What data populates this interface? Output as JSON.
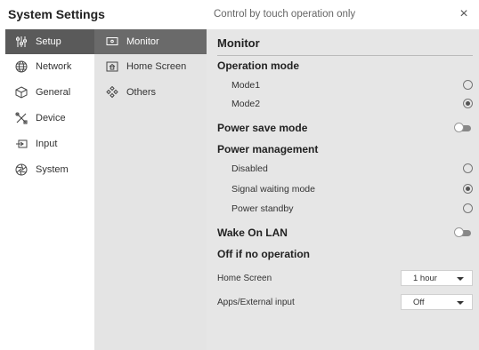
{
  "window": {
    "title": "System Settings",
    "hint": "Control by touch operation only",
    "close_glyph": "×"
  },
  "nav": {
    "items": [
      {
        "label": "Setup",
        "icon": "sliders-icon"
      },
      {
        "label": "Network",
        "icon": "globe-icon"
      },
      {
        "label": "General",
        "icon": "cube-icon"
      },
      {
        "label": "Device",
        "icon": "tools-icon"
      },
      {
        "label": "Input",
        "icon": "input-icon"
      },
      {
        "label": "System",
        "icon": "aperture-icon"
      }
    ],
    "active": "Setup"
  },
  "subnav": {
    "items": [
      {
        "label": "Monitor",
        "icon": "monitor-icon"
      },
      {
        "label": "Home Screen",
        "icon": "home-icon"
      },
      {
        "label": "Others",
        "icon": "diamonds-icon"
      }
    ],
    "active": "Monitor"
  },
  "panel": {
    "title": "Monitor",
    "operation_mode": {
      "heading": "Operation mode",
      "options": [
        {
          "label": "Mode1",
          "selected": false
        },
        {
          "label": "Mode2",
          "selected": true
        }
      ]
    },
    "power_save": {
      "label": "Power save mode",
      "on": false
    },
    "power_management": {
      "heading": "Power management",
      "options": [
        {
          "label": "Disabled",
          "selected": false
        },
        {
          "label": "Signal waiting mode",
          "selected": true
        },
        {
          "label": "Power standby",
          "selected": false
        }
      ]
    },
    "wake_on_lan": {
      "label": "Wake On LAN",
      "on": false
    },
    "off_if_no_op": {
      "heading": "Off if no operation",
      "rows": [
        {
          "label": "Home Screen",
          "value": "1 hour"
        },
        {
          "label": "Apps/External input",
          "value": "Off"
        }
      ]
    }
  },
  "colors": {
    "nav_active_bg": "#5a5a5a",
    "subnav_bg": "#e4e4e4",
    "panel_bg": "#e6e6e6"
  }
}
